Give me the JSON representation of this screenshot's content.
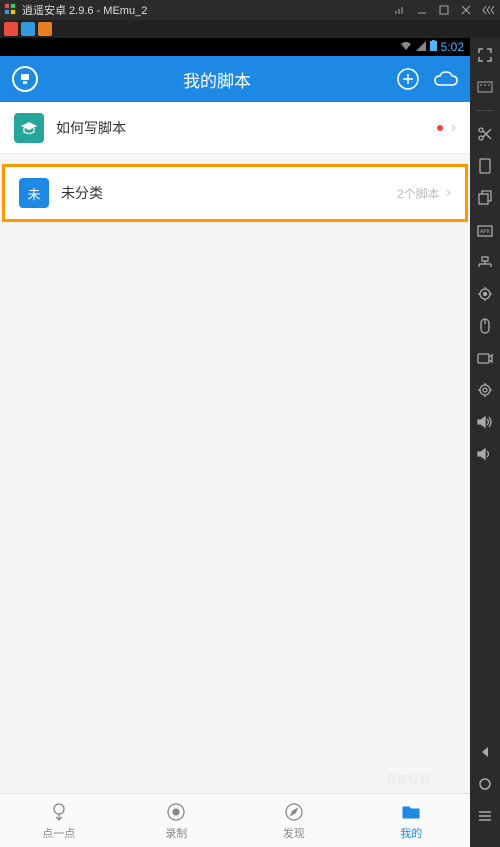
{
  "emulator": {
    "title": "逍遥安卓 2.9.6 - MEmu_2"
  },
  "android_status": {
    "time": "5:02"
  },
  "app_header": {
    "title": "我的脚本"
  },
  "rows": {
    "tutorial": {
      "title": "如何写脚本"
    },
    "uncategorized": {
      "title": "未分类",
      "count": "2个脚本"
    }
  },
  "tabs": {
    "tap": "点一点",
    "record": "录制",
    "discover": "发现",
    "mine": "我的"
  },
  "watermark": "百度经验"
}
